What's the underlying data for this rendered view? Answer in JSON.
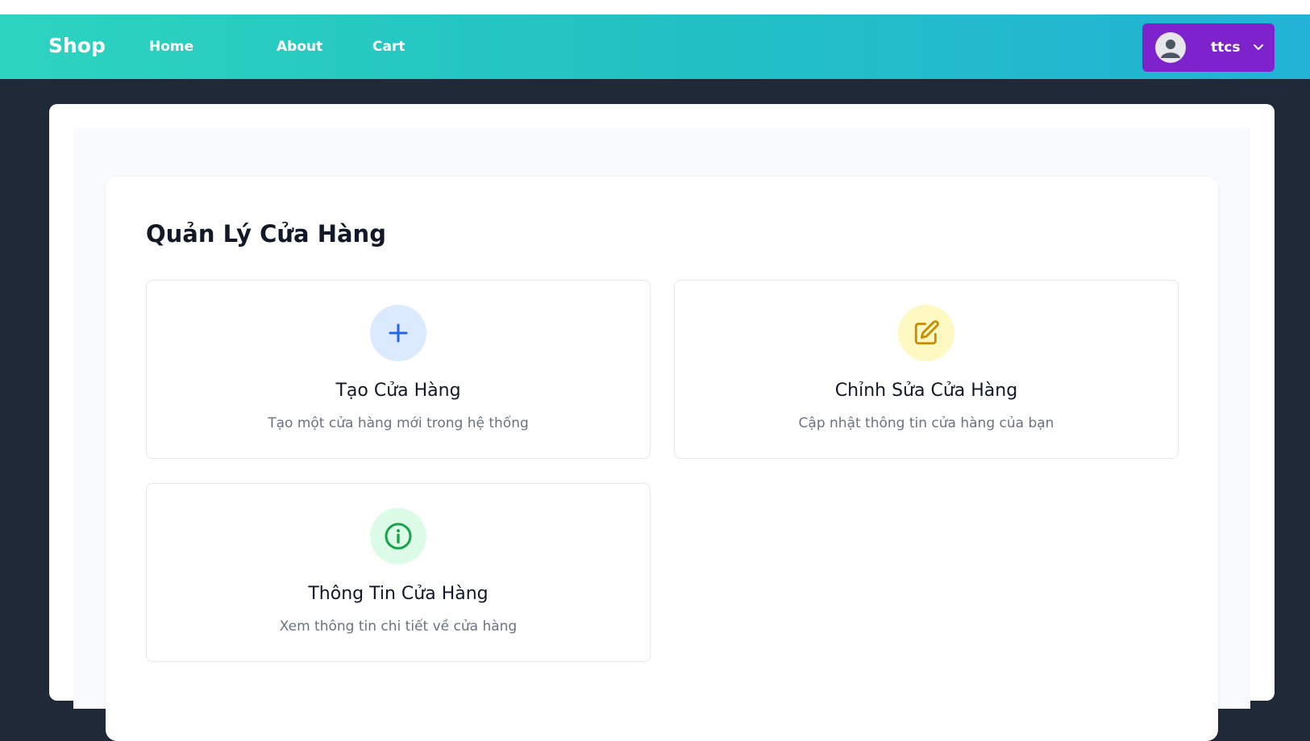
{
  "navbar": {
    "brand": "Shop",
    "links": [
      {
        "label": "Home"
      },
      {
        "label": "About"
      },
      {
        "label": "Cart"
      }
    ],
    "user": {
      "name": "ttcs"
    }
  },
  "main": {
    "title": "Quản Lý Cửa Hàng",
    "cards": [
      {
        "title": "Tạo Cửa Hàng",
        "description": "Tạo một cửa hàng mới trong hệ thống",
        "icon": "plus-icon",
        "icon_color": "#2563eb",
        "icon_bg": "#dbeafe"
      },
      {
        "title": "Chỉnh Sửa Cửa Hàng",
        "description": "Cập nhật thông tin cửa hàng của bạn",
        "icon": "edit-icon",
        "icon_color": "#ca8a04",
        "icon_bg": "#fef9c3"
      },
      {
        "title": "Thông Tin Cửa Hàng",
        "description": "Xem thông tin chi tiết về cửa hàng",
        "icon": "info-icon",
        "icon_color": "#16a34a",
        "icon_bg": "#dcfce7"
      }
    ]
  },
  "colors": {
    "navbar_gradient_start": "#2dd4bf",
    "navbar_gradient_end": "#22b3d6",
    "user_button": "#7e22ce",
    "page_background": "#1f2937"
  }
}
